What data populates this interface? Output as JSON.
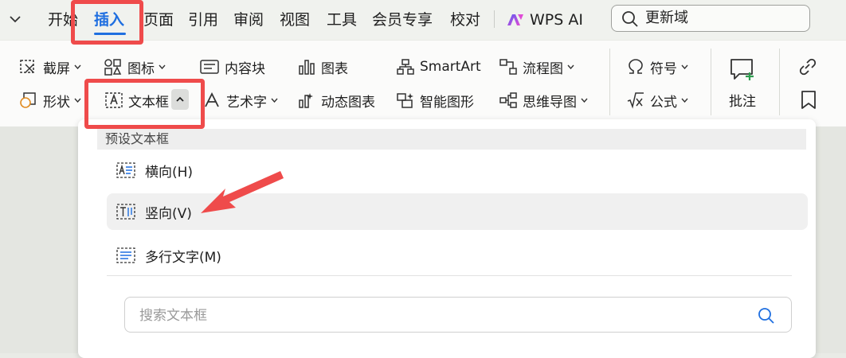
{
  "menu": {
    "tabs": [
      "开始",
      "插入",
      "页面",
      "引用",
      "审阅",
      "视图",
      "工具",
      "会员专享",
      "校对"
    ],
    "active_tab": "插入",
    "ai_label": "WPS AI",
    "search_text": "更新域"
  },
  "ribbon": {
    "screenshot": "截屏",
    "icons": "图标",
    "content_block": "内容块",
    "chart": "图表",
    "smartart": "SmartArt",
    "flowchart": "流程图",
    "symbol": "符号",
    "shape": "形状",
    "textbox": "文本框",
    "wordart": "艺术字",
    "dynamic_chart": "动态图表",
    "smart_shape": "智能图形",
    "mindmap": "思维导图",
    "formula": "公式",
    "comment": "批注"
  },
  "dropdown": {
    "header": "预设文本框",
    "items": [
      {
        "label": "横向(H)",
        "icon": "horizontal-textbox-icon"
      },
      {
        "label": "竖向(V)",
        "icon": "vertical-textbox-icon"
      },
      {
        "label": "多行文字(M)",
        "icon": "multiline-text-icon"
      }
    ],
    "search_placeholder": "搜索文本框"
  },
  "colors": {
    "accent": "#1f6fe0",
    "highlight": "#ef4b4b"
  }
}
